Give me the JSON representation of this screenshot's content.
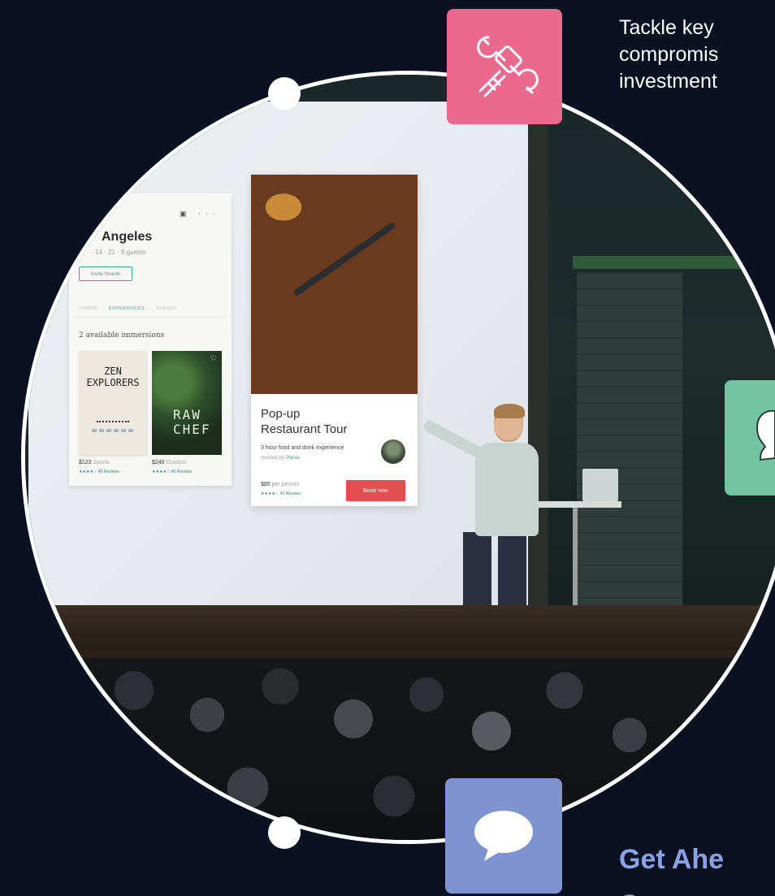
{
  "intro": {
    "lines": [
      "Tackle key",
      "compromis",
      "investment"
    ]
  },
  "heading": {
    "lines": [
      "Get Ahe",
      "Conver"
    ]
  },
  "slide": {
    "left_card": {
      "title": "Angeles",
      "subtitle": "14 · 21 · 6 guests",
      "invite_label": "Invite friends",
      "tabs": [
        "HOMES",
        "EXPERIENCES",
        "PLACES"
      ],
      "available": "2 available immersions",
      "items": [
        {
          "poster_text": "ZEN\nEXPLORERS",
          "price": "$123",
          "category": "Sports",
          "reviews": "★★★★☆ 45 Reviews"
        },
        {
          "poster_text": "RAW\nCHEF",
          "price": "$240",
          "category": "Outdoor",
          "reviews": "★★★★☆ 45 Reviews"
        }
      ]
    },
    "tour_card": {
      "title": "Pop-up Restaurant Tour",
      "description": "3 hour food and drink experience",
      "host_prefix": "Hosted by",
      "host_name": "Paola",
      "price": "$85",
      "price_unit": "per person",
      "reviews": "★★★★☆ 45 Reviews",
      "book_label": "Book now"
    }
  },
  "icons": {
    "tools": "wrench-fist-icon",
    "green": "person-bubble-icon",
    "chat": "chat-bubble-icon"
  },
  "colors": {
    "background": "#0b1120",
    "tile_pink": "#e9698f",
    "tile_green": "#73c4a3",
    "tile_blue": "#7f93d1",
    "heading": "#8aa2e6",
    "book_button": "#e24d4d"
  }
}
